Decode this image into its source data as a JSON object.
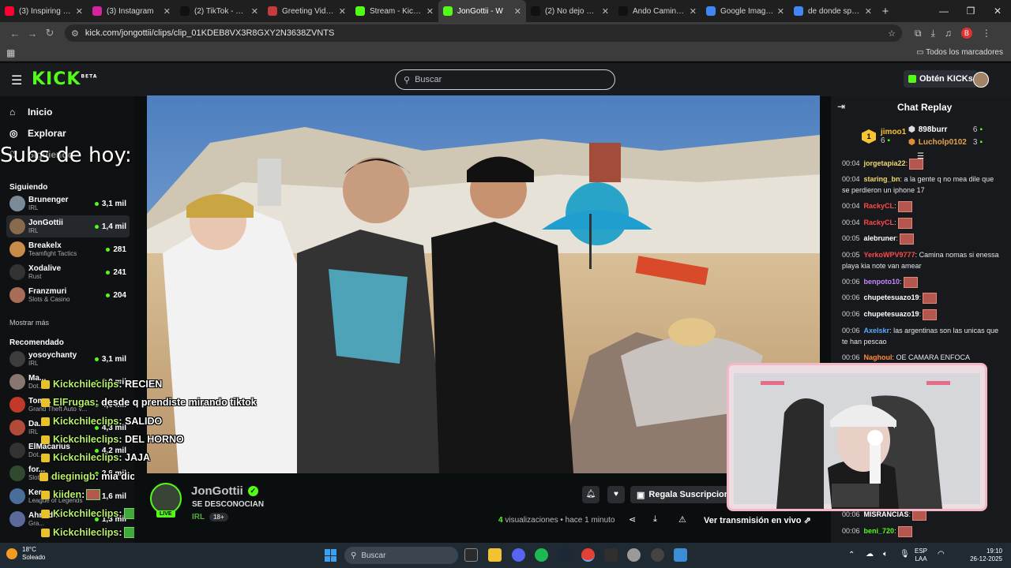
{
  "browser": {
    "tabs": [
      {
        "title": "(3) Inspiring and Uplifting",
        "color": "#ff0033"
      },
      {
        "title": "(3) Instagram",
        "color": "#d6249f"
      },
      {
        "title": "(2) TikTok - Make Your Day",
        "color": "#111111"
      },
      {
        "title": "Greeting Video from",
        "color": "#c63b3b"
      },
      {
        "title": "Stream - Kick Dashboard",
        "color": "#53fc18"
      },
      {
        "title": "JonGottii - W",
        "color": "#53fc18",
        "active": true
      },
      {
        "title": "(2) No dejo nada",
        "color": "#111111"
      },
      {
        "title": "Ando Caminando",
        "color": "#111111"
      },
      {
        "title": "Google Image Result",
        "color": "#4285f4"
      },
      {
        "title": "de donde spon los",
        "color": "#4285f4"
      }
    ],
    "url": "kick.com/jongottii/clips/clip_01KDEB8VX3R8GXY2N3638ZVNTS",
    "all_bookmarks": "Todos los marcadores",
    "profile_letter": "B"
  },
  "header": {
    "logo": "KICK",
    "logo_beta": "BETA",
    "search_placeholder": "Buscar",
    "get_kicks": "Obtén KICKs"
  },
  "sidebar": {
    "nav": [
      {
        "label": "Inicio",
        "icon": "home-icon"
      },
      {
        "label": "Explorar",
        "icon": "compass-icon"
      },
      {
        "label": "Siguiendo",
        "icon": "heart-icon"
      }
    ],
    "overlay_text": "Subs de hoy:",
    "following_title": "Siguiendo",
    "following": [
      {
        "name": "Brunenger",
        "cat": "IRL",
        "viewers": "3,1 mil",
        "color": "#7b8a99"
      },
      {
        "name": "JonGottii",
        "cat": "IRL",
        "viewers": "1,4 mil",
        "color": "#8a6a4d",
        "selected": true
      },
      {
        "name": "Breakelx",
        "cat": "Teamfight Tactics",
        "viewers": "281",
        "color": "#c98b4a"
      },
      {
        "name": "Xodalive",
        "cat": "Rust",
        "viewers": "241",
        "color": "#333333"
      },
      {
        "name": "Franzmuri",
        "cat": "Slots & Casino",
        "viewers": "204",
        "color": "#a86d56"
      }
    ],
    "show_more": "Mostrar más",
    "recommended_title": "Recomendado",
    "recommended": [
      {
        "name": "yosoychanty",
        "cat": "IRL",
        "viewers": "3,1 mil",
        "color": "#3d3d3d"
      },
      {
        "name": "Ma...",
        "cat": "Dot...",
        "viewers": "3,0 mil",
        "color": "#8a7670"
      },
      {
        "name": "Tom...",
        "cat": "Grand Theft Auto V...",
        "viewers": "4,6 mil",
        "color": "#c0392b"
      },
      {
        "name": "Da...",
        "cat": "IRL",
        "viewers": "4,3 mil",
        "color": "#b24a3a"
      },
      {
        "name": "ElMacarius",
        "cat": "Dot...",
        "viewers": "4,2 mil",
        "color": "#333333"
      },
      {
        "name": "for...",
        "cat": "Slots & Casino",
        "viewers": "2,8 mil",
        "color": "#2f4a2f"
      },
      {
        "name": "Ker...",
        "cat": "League of Legends",
        "viewers": "1,6 mil",
        "color": "#4a6e9a"
      },
      {
        "name": "Ahnadna",
        "cat": "Gra...",
        "viewers": "1,3 mil",
        "color": "#5b6a9a"
      }
    ]
  },
  "overlay_chat": [
    {
      "user": "Kickchileclips",
      "msg": ": RECIEN"
    },
    {
      "user": "ElFrugas",
      "msg": ": desde q prendiste mirando tiktok"
    },
    {
      "user": "Kickchileclips",
      "msg": ": SALIDO"
    },
    {
      "user": "Kickchileclips",
      "msg": ": DEL HORNO"
    },
    {
      "user": "Kickchileclips",
      "msg": ": JAJA"
    },
    {
      "user": "dieginigb",
      "msg": ": mia dice"
    },
    {
      "user": "kiiden",
      "msg": ":"
    },
    {
      "user": "Kickchileclips",
      "msg": ":"
    },
    {
      "user": "Kickchileclips",
      "msg": ":"
    }
  ],
  "stream": {
    "name": "JonGottii",
    "title": "SE DESCONOCIAN",
    "category": "IRL",
    "age": "18+",
    "live": "LIVE",
    "gift_subs": "Regala Suscripciones",
    "views_count": "4",
    "views_label": "visualizaciones",
    "time": "hace 1 minuto",
    "watch_live": "Ver transmisión en vivo"
  },
  "chat": {
    "title": "Chat Replay",
    "top_gifters": [
      {
        "name": "jimoo1",
        "count": "6",
        "rank": "1"
      },
      {
        "name": "898burr",
        "count": "6"
      },
      {
        "name": "Lucholp0102",
        "count": "3"
      }
    ],
    "messages": [
      {
        "time": "00:04",
        "user": "jorgetapia22",
        "text": ":",
        "color": "#f0d96b",
        "emote": true
      },
      {
        "time": "00:04",
        "user": "staring_bn",
        "text": ": a la gente q no mea dile que se perdieron un iphone 17",
        "color": "#f0d96b"
      },
      {
        "time": "00:04",
        "user": "RackyCL",
        "text": ":",
        "color": "#ff4a4a",
        "emote": true
      },
      {
        "time": "00:04",
        "user": "RackyCL",
        "text": ":",
        "color": "#ff4a4a",
        "emote": true
      },
      {
        "time": "00:05",
        "user": "alebruner",
        "text": ":",
        "color": "#ffffff",
        "emote": true
      },
      {
        "time": "00:05",
        "user": "YerkoWPV9777",
        "text": ": Camina nomas si enessa playa kia note van amear",
        "color": "#ff4a4a"
      },
      {
        "time": "00:06",
        "user": "benpoto10",
        "text": ":",
        "color": "#c48aff",
        "emote": true
      },
      {
        "time": "00:06",
        "user": "chupetesuazo19",
        "text": ":",
        "color": "#ffffff",
        "emote": true
      },
      {
        "time": "00:06",
        "user": "chupetesuazo19",
        "text": ":",
        "color": "#ffffff",
        "emote": true
      },
      {
        "time": "00:06",
        "user": "Axelskr",
        "text": ": las argentinas son las unicas que te han pescao",
        "color": "#5aa9ff"
      },
      {
        "time": "00:06",
        "user": "Naghoul",
        "text": ": OE CAMARA ENFOCA",
        "color": "#ff8a3a"
      },
      {
        "time": "00:06",
        "user": "MISRANCIAS",
        "text": ":",
        "color": "#ffffff",
        "emote": true
      },
      {
        "time": "00:06",
        "user": "beni_720",
        "text": ":",
        "color": "#53fc18",
        "emote": true
      }
    ]
  },
  "taskbar": {
    "temp": "18°C",
    "weather": "Soleado",
    "search": "Buscar",
    "lang": "ESP",
    "lang2": "LAA",
    "time": "19:10",
    "date": "26-12-2025"
  }
}
